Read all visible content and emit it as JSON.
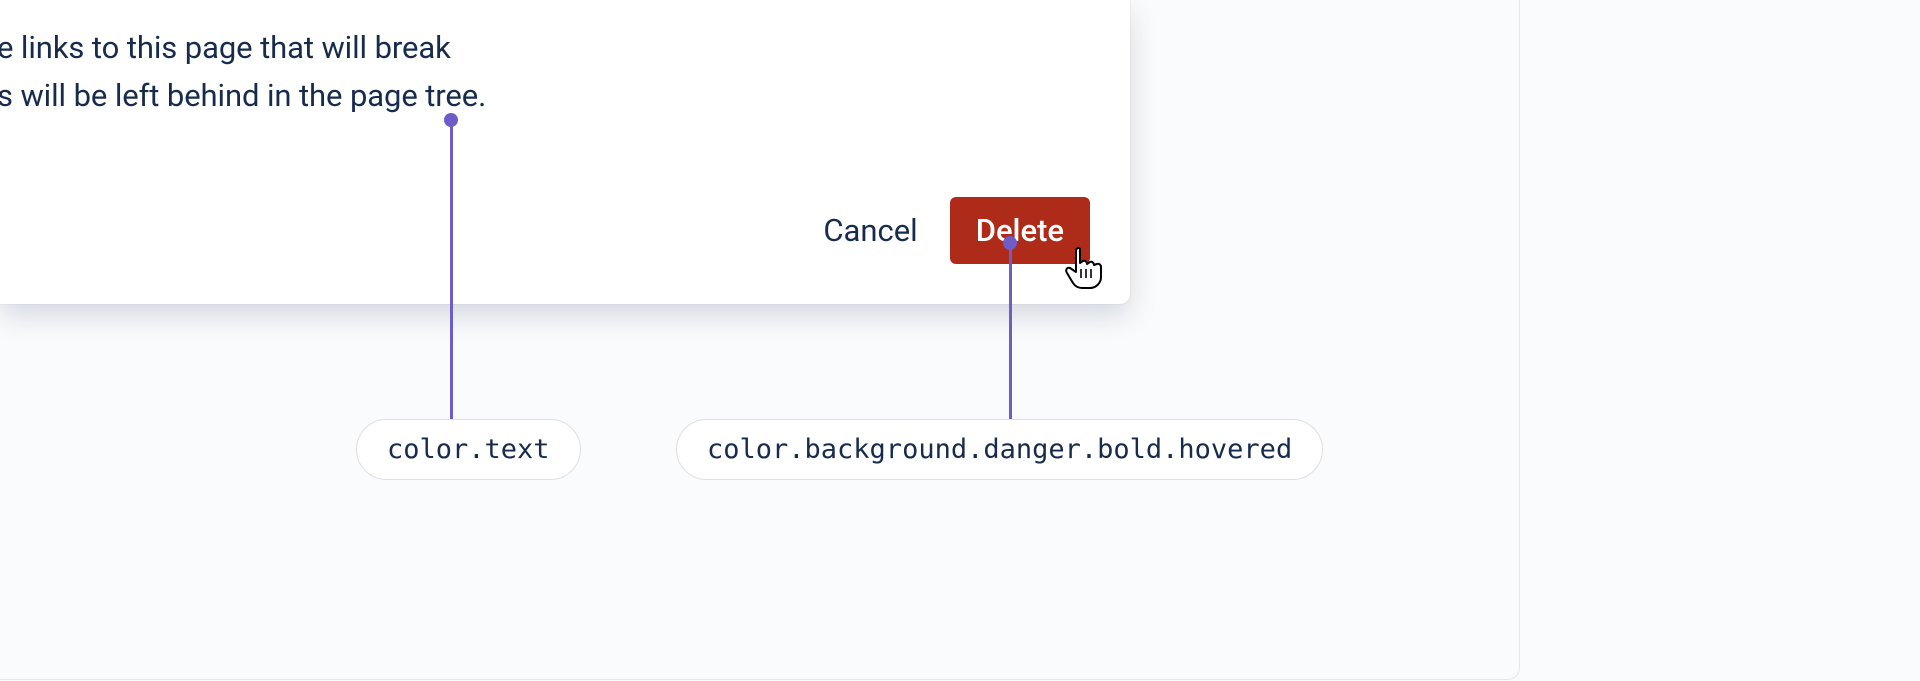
{
  "dialog": {
    "body_line1": "e links to this page that will break",
    "body_line2": "s will be left behind in the page tree.",
    "cancel_label": "Cancel",
    "delete_label": "Delete"
  },
  "annotations": {
    "text_token": "color.text",
    "button_token": "color.background.danger.bold.hovered"
  },
  "colors": {
    "text": "#172b4d",
    "danger_bold_hovered": "#ae2a19",
    "annotation": "#6e5dc6"
  }
}
